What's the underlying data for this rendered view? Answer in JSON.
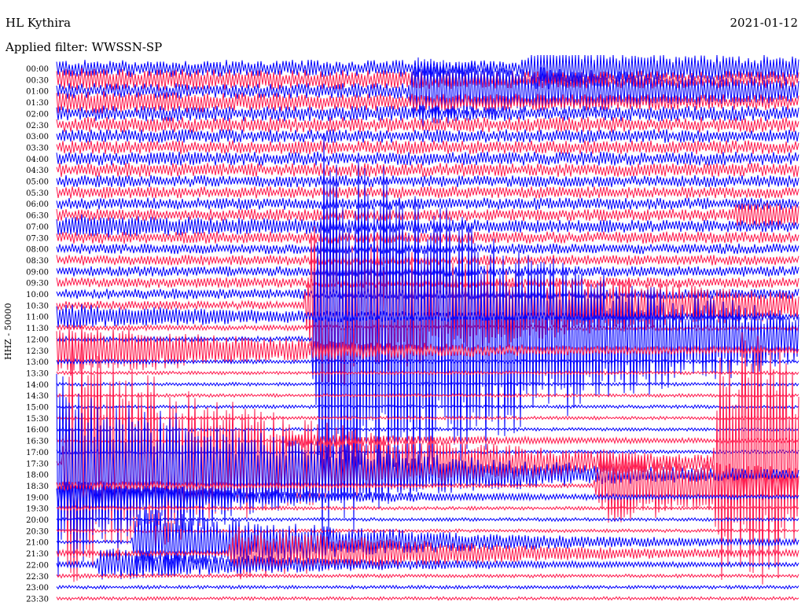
{
  "header": {
    "station": "HL Kythira",
    "date": "2021-01-12",
    "filter": "Applied filter: WWSSN-SP"
  },
  "chart_data": {
    "type": "line",
    "title": "HL Kythira",
    "ylabel": "HHZ - 50000",
    "colors": [
      "#0000ff",
      "#ff1a4d"
    ],
    "rows": [
      "00:00",
      "00:30",
      "01:00",
      "01:30",
      "02:00",
      "02:30",
      "03:00",
      "03:30",
      "04:00",
      "04:30",
      "05:00",
      "05:30",
      "06:00",
      "06:30",
      "07:00",
      "07:30",
      "08:00",
      "08:30",
      "09:00",
      "09:30",
      "10:00",
      "10:30",
      "11:00",
      "11:30",
      "12:00",
      "12:30",
      "13:00",
      "13:30",
      "14:00",
      "14:30",
      "15:00",
      "15:30",
      "16:00",
      "16:30",
      "17:00",
      "17:30",
      "18:00",
      "18:30",
      "19:00",
      "19:30",
      "20:00",
      "20:30",
      "21:00",
      "21:30",
      "22:00",
      "22:30",
      "23:00",
      "23:30"
    ],
    "noise_level": [
      10,
      10,
      9,
      9,
      9,
      9,
      8,
      8,
      8,
      8,
      7,
      7,
      7,
      7,
      7,
      7,
      6,
      6,
      6,
      6,
      6,
      5,
      4,
      3,
      3,
      3,
      2,
      2,
      2,
      2,
      2,
      2,
      2,
      2,
      2,
      2,
      2,
      2,
      2,
      2,
      2,
      2,
      2,
      2,
      2,
      2,
      2,
      2
    ],
    "events": [
      {
        "row": "00:00",
        "minute": 19.3,
        "amplitude": 18
      },
      {
        "row": "01:00",
        "minute": 14.5,
        "amplitude": 40
      },
      {
        "row": "06:30",
        "minute": 27.5,
        "amplitude": 12
      },
      {
        "row": "10:30",
        "minute": 10.3,
        "amplitude": 120
      },
      {
        "row": "12:00",
        "minute": 10.6,
        "amplitude": 300
      },
      {
        "row": "16:30",
        "minute": 9.3,
        "amplitude": 8
      },
      {
        "row": "17:30",
        "minute": 0.5,
        "amplitude": 160
      },
      {
        "row": "17:30",
        "minute": 26.8,
        "amplitude": 190
      },
      {
        "row": "18:30",
        "minute": 22.0,
        "amplitude": 50
      },
      {
        "row": "21:00",
        "minute": 3.3,
        "amplitude": 45
      },
      {
        "row": "21:30",
        "minute": 7.2,
        "amplitude": 35
      },
      {
        "row": "22:00",
        "minute": 1.8,
        "amplitude": 20
      }
    ]
  }
}
